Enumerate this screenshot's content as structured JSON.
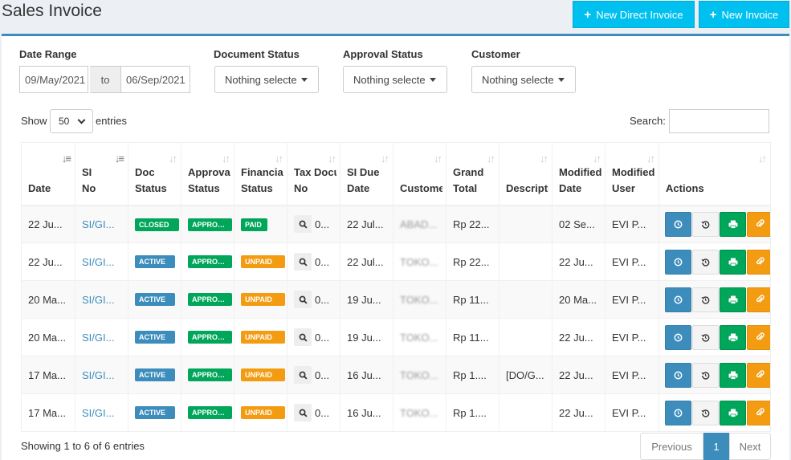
{
  "page": {
    "title": "Sales Invoice"
  },
  "header_buttons": {
    "direct": "New Direct Invoice",
    "new": "New Invoice"
  },
  "filters": {
    "date_range_label": "Date Range",
    "date_from": "09/May/2021",
    "date_to_sep": "to",
    "date_to": "06/Sep/2021",
    "doc_status_label": "Document Status",
    "doc_status_value": "Nothing selecte",
    "approval_status_label": "Approval Status",
    "approval_status_value": "Nothing selecte",
    "customer_label": "Customer",
    "customer_value": "Nothing selecte"
  },
  "table_controls": {
    "show": "Show",
    "entries_value": "50",
    "entries": "entries",
    "search": "Search:"
  },
  "columns": [
    {
      "l1": "",
      "l2": "Date"
    },
    {
      "l1": "SI",
      "l2": "No"
    },
    {
      "l1": "Doc",
      "l2": "Status"
    },
    {
      "l1": "Approval",
      "l2": "Status"
    },
    {
      "l1": "Financial",
      "l2": "Status"
    },
    {
      "l1": "Tax Document",
      "l2": "No"
    },
    {
      "l1": "SI Due",
      "l2": "Date"
    },
    {
      "l1": "",
      "l2": "Customer"
    },
    {
      "l1": "Grand",
      "l2": "Total"
    },
    {
      "l1": "",
      "l2": "Description"
    },
    {
      "l1": "Modified",
      "l2": "Date"
    },
    {
      "l1": "Modified",
      "l2": "User"
    },
    {
      "l1": "",
      "l2": "Actions"
    }
  ],
  "rows": [
    {
      "date": "22 Ju...",
      "si_no": "SI/GI...",
      "doc_status": "CLOSED",
      "doc_color": "green",
      "approval": "APPROVED",
      "financial": "PAID",
      "fin_color": "green",
      "tax": "0...",
      "due": "22 Jul...",
      "customer": "ABAD...",
      "total": "Rp 22...",
      "desc": "",
      "mod_date": "02 Se...",
      "mod_user": "EVI P..."
    },
    {
      "date": "22 Ju...",
      "si_no": "SI/GI...",
      "doc_status": "ACTIVE",
      "doc_color": "blue",
      "approval": "APPROVED",
      "financial": "UNPAID",
      "fin_color": "orange",
      "tax": "0...",
      "due": "22 Jul...",
      "customer": "TOKO...",
      "total": "Rp 22...",
      "desc": "",
      "mod_date": "22 Ju...",
      "mod_user": "EVI P..."
    },
    {
      "date": "20 Ma...",
      "si_no": "SI/GI...",
      "doc_status": "ACTIVE",
      "doc_color": "blue",
      "approval": "APPROVED",
      "financial": "UNPAID",
      "fin_color": "orange",
      "tax": "0...",
      "due": "19 Ju...",
      "customer": "TOKO...",
      "total": "Rp 11...",
      "desc": "",
      "mod_date": "20 Ma...",
      "mod_user": "EVI P..."
    },
    {
      "date": "20 Ma...",
      "si_no": "SI/GI...",
      "doc_status": "ACTIVE",
      "doc_color": "blue",
      "approval": "APPROVED",
      "financial": "UNPAID",
      "fin_color": "orange",
      "tax": "0...",
      "due": "19 Ju...",
      "customer": "TOKO...",
      "total": "Rp 11...",
      "desc": "",
      "mod_date": "22 Ju...",
      "mod_user": "EVI P..."
    },
    {
      "date": "17 Ma...",
      "si_no": "SI/GI...",
      "doc_status": "ACTIVE",
      "doc_color": "blue",
      "approval": "APPROVED",
      "financial": "UNPAID",
      "fin_color": "orange",
      "tax": "0...",
      "due": "16 Ju...",
      "customer": "TOKO...",
      "total": "Rp 1....",
      "desc": "[DO/G...",
      "mod_date": "22 Ju...",
      "mod_user": "EVI P..."
    },
    {
      "date": "17 Ma...",
      "si_no": "SI/GI...",
      "doc_status": "ACTIVE",
      "doc_color": "blue",
      "approval": "APPROVED",
      "financial": "UNPAID",
      "fin_color": "orange",
      "tax": "0...",
      "due": "16 Ju...",
      "customer": "TOKO...",
      "total": "Rp 1....",
      "desc": "",
      "mod_date": "22 Ju...",
      "mod_user": "EVI P..."
    }
  ],
  "footer": {
    "info": "Showing 1 to 6 of 6 entries",
    "prev": "Previous",
    "page": "1",
    "next": "Next"
  },
  "colors": {
    "accent": "#3c8dbc",
    "info_button": "#00c0ef",
    "success": "#00a65a",
    "warning": "#f39c12"
  }
}
